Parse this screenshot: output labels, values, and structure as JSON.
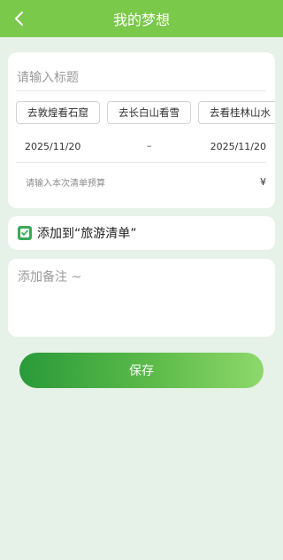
{
  "header": {
    "title": "我的梦想",
    "back_icon": "chevron-left-icon"
  },
  "form": {
    "title_placeholder": "请输入标题",
    "tags": [
      "去敦煌看石窟",
      "去长白山看雪",
      "去看桂林山水"
    ],
    "start_date": "2025/11/20",
    "date_separator": "–",
    "end_date": "2025/11/20",
    "budget_placeholder": "请输入本次清单预算",
    "currency": "¥"
  },
  "add_to_list": {
    "label": "添加到“旅游清单”",
    "icon": "check-note-icon",
    "accent": "#3ca95a"
  },
  "notes": {
    "placeholder": "添加备注 ~"
  },
  "save_button": {
    "label": "保存"
  },
  "colors": {
    "header": "#7bc94a",
    "background": "#e6f1e8"
  }
}
